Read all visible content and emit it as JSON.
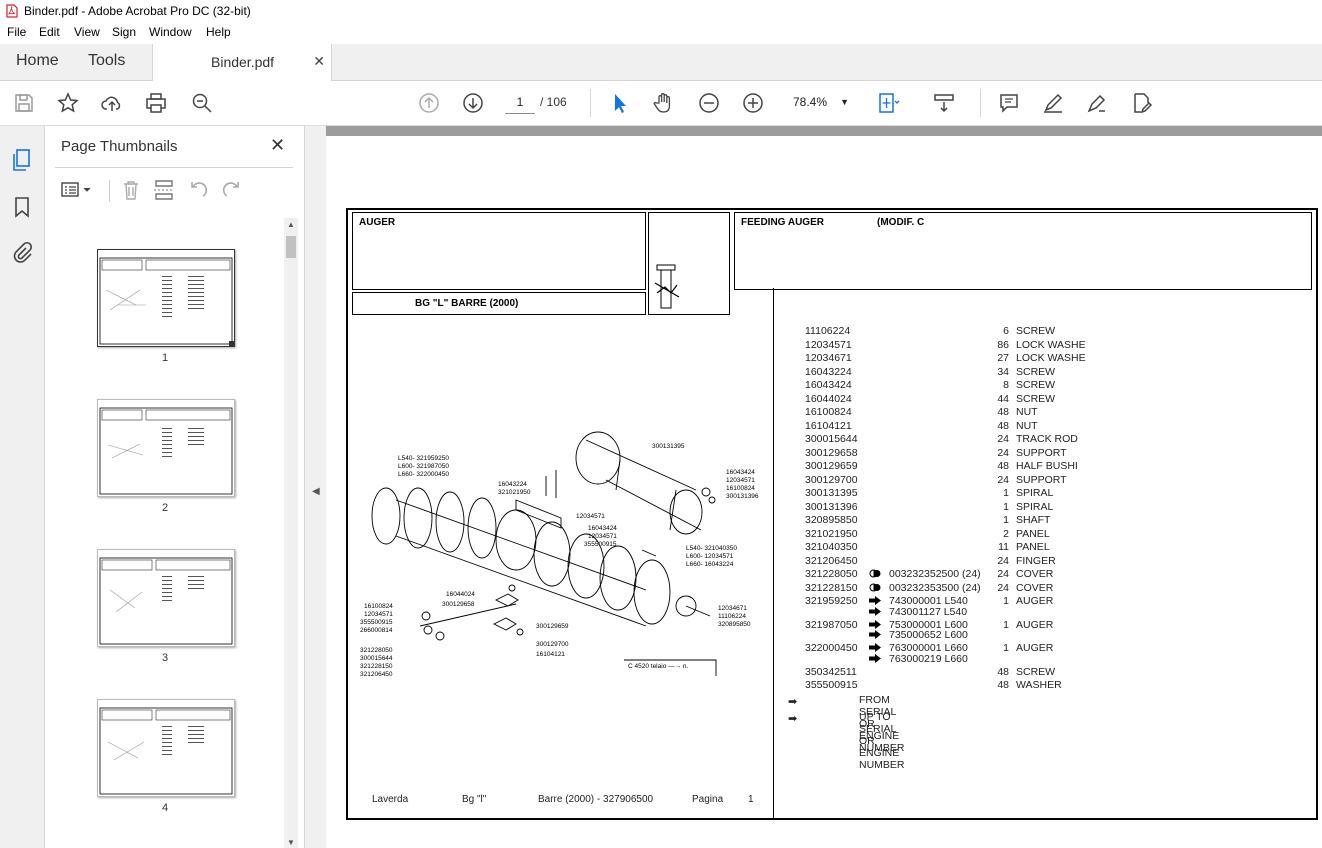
{
  "window": {
    "title": "Binder.pdf - Adobe Acrobat Pro DC (32-bit)"
  },
  "menu": [
    "File",
    "Edit",
    "View",
    "Sign",
    "Window",
    "Help"
  ],
  "tabs": {
    "home": "Home",
    "tools": "Tools",
    "document": "Binder.pdf"
  },
  "nav": {
    "current_page": "1",
    "total_pages": "/ 106",
    "zoom": "78.4%"
  },
  "panel": {
    "title": "Page Thumbnails",
    "thumbnails": [
      "1",
      "2",
      "3",
      "4"
    ]
  },
  "colors": {
    "accent": "#1473e6",
    "selection_border": "#333333",
    "scrollbar": "#c1c1c1"
  },
  "document": {
    "header_left": "AUGER",
    "header_right": "FEEDING AUGER",
    "header_modif": "(MODIF. C",
    "model": "BG \"L\" BARRE (2000)",
    "parts": [
      {
        "code": "11106224",
        "sym": "",
        "ref": "",
        "qty": "6",
        "desc": "SCREW"
      },
      {
        "code": "12034571",
        "sym": "",
        "ref": "",
        "qty": "86",
        "desc": "LOCK WASHE"
      },
      {
        "code": "12034671",
        "sym": "",
        "ref": "",
        "qty": "27",
        "desc": "LOCK WASHE"
      },
      {
        "code": "16043224",
        "sym": "",
        "ref": "",
        "qty": "34",
        "desc": "SCREW"
      },
      {
        "code": "16043424",
        "sym": "",
        "ref": "",
        "qty": "8",
        "desc": "SCREW"
      },
      {
        "code": "16044024",
        "sym": "",
        "ref": "",
        "qty": "44",
        "desc": "SCREW"
      },
      {
        "code": "16100824",
        "sym": "",
        "ref": "",
        "qty": "48",
        "desc": "NUT"
      },
      {
        "code": "16104121",
        "sym": "",
        "ref": "",
        "qty": "48",
        "desc": "NUT"
      },
      {
        "code": "300015644",
        "sym": "",
        "ref": "",
        "qty": "24",
        "desc": "TRACK ROD"
      },
      {
        "code": "300129658",
        "sym": "",
        "ref": "",
        "qty": "24",
        "desc": "SUPPORT"
      },
      {
        "code": "300129659",
        "sym": "",
        "ref": "",
        "qty": "48",
        "desc": "HALF BUSHI"
      },
      {
        "code": "300129700",
        "sym": "",
        "ref": "",
        "qty": "24",
        "desc": "SUPPORT"
      },
      {
        "code": "300131395",
        "sym": "",
        "ref": "",
        "qty": "1",
        "desc": "SPIRAL"
      },
      {
        "code": "300131396",
        "sym": "",
        "ref": "",
        "qty": "1",
        "desc": "SPIRAL"
      },
      {
        "code": "320895850",
        "sym": "",
        "ref": "",
        "qty": "1",
        "desc": "SHAFT"
      },
      {
        "code": "321021950",
        "sym": "",
        "ref": "",
        "qty": "2",
        "desc": "PANEL"
      },
      {
        "code": "321040350",
        "sym": "",
        "ref": "",
        "qty": "11",
        "desc": "PANEL"
      },
      {
        "code": "321206450",
        "sym": "",
        "ref": "",
        "qty": "24",
        "desc": "FINGER"
      },
      {
        "code": "321228050",
        "sym": "toggle",
        "ref": "003232352500  (24)",
        "qty": "24",
        "desc": "COVER"
      },
      {
        "code": "321228150",
        "sym": "toggle",
        "ref": "003232353500  (24)",
        "qty": "24",
        "desc": "COVER"
      },
      {
        "code": "321959250",
        "sym": "from",
        "ref": "743000001 L540",
        "qty": "1",
        "desc": "AUGER"
      },
      {
        "code": "",
        "sym": "upto",
        "ref": "743001127 L540",
        "qty": "",
        "desc": ""
      },
      {
        "code": "321987050",
        "sym": "from",
        "ref": "753000001 L600",
        "qty": "1",
        "desc": "AUGER"
      },
      {
        "code": "",
        "sym": "upto",
        "ref": "735000652 L600",
        "qty": "",
        "desc": ""
      },
      {
        "code": "322000450",
        "sym": "from",
        "ref": "763000001 L660",
        "qty": "1",
        "desc": "AUGER"
      },
      {
        "code": "",
        "sym": "upto",
        "ref": "763000219 L660",
        "qty": "",
        "desc": ""
      },
      {
        "code": "350342511",
        "sym": "",
        "ref": "",
        "qty": "48",
        "desc": "SCREW"
      },
      {
        "code": "355500915",
        "sym": "",
        "ref": "",
        "qty": "48",
        "desc": "WASHER"
      }
    ],
    "legend_from": "FROM SERIAL OR ENGINE NUMBER",
    "legend_upto": "UP TO SERIAL OR ENGINE NUMBER",
    "diagram_labels": {
      "l540": "L540-  321959250",
      "l600": "L600-  321987050",
      "l660": "L660-  322000450",
      "top1": "300131395",
      "r1": "16043424",
      "r2": "12034571",
      "r3": "16100824",
      "r4": "300131396",
      "m1": "16043224",
      "m2": "321021950",
      "m3": "12034571",
      "m4": "16043424",
      "m5": "12034571",
      "m6": "355500915",
      "p1": "L540-  321040350",
      "p2": "L600-  12034571",
      "p3": "L660-  16043224",
      "b1": "16044024",
      "b2": "300129658",
      "b3": "300129659",
      "b4": "300129700",
      "b5": "16104121",
      "rr1": "12034671",
      "rr2": "11106224",
      "rr3": "320895850",
      "l1": "16100824",
      "l2": "12034571",
      "l3": "355500915",
      "l4": "266000814",
      "l5": "321228050",
      "l6": "300015644",
      "l7": "321228150",
      "l8": "321206450",
      "frame": "C 4520 telaio  —→ n."
    },
    "footer": {
      "brand": "Laverda",
      "model": "Bg \"l\"",
      "series": "Barre (2000) - 327906500",
      "page_label": "Pagina",
      "page_no": "1"
    }
  }
}
